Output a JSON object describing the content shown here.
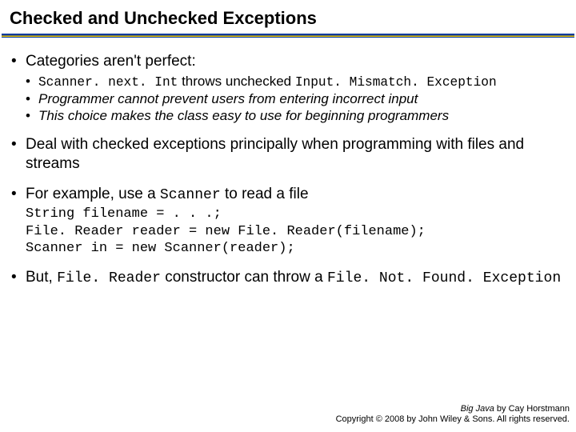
{
  "title": "Checked and Unchecked Exceptions",
  "bullets": {
    "b1": {
      "text": "Categories aren't perfect:",
      "sub": {
        "s1_pre": "",
        "s1_code1": "Scanner. next. Int",
        "s1_mid": " throws unchecked ",
        "s1_code2": "Input. Mismatch. Exception",
        "s2": "Programmer cannot prevent users from entering incorrect input",
        "s3": "This choice makes the class easy to use for beginning programmers"
      }
    },
    "b2": "Deal with checked exceptions principally when programming with files and streams",
    "b3_pre": "For example, use a ",
    "b3_code": "Scanner",
    "b3_post": " to read a file",
    "code": "String filename = . . .;\nFile. Reader reader = new File. Reader(filename);\nScanner in = new Scanner(reader);",
    "b4_pre": "But, ",
    "b4_code1": "File. Reader",
    "b4_mid": " constructor can throw a ",
    "b4_code2": "File. Not. Found. Exception"
  },
  "footer": {
    "line1_italic": "Big Java",
    "line1_rest": " by Cay Horstmann",
    "line2": "Copyright © 2008 by John Wiley & Sons. All rights reserved."
  }
}
